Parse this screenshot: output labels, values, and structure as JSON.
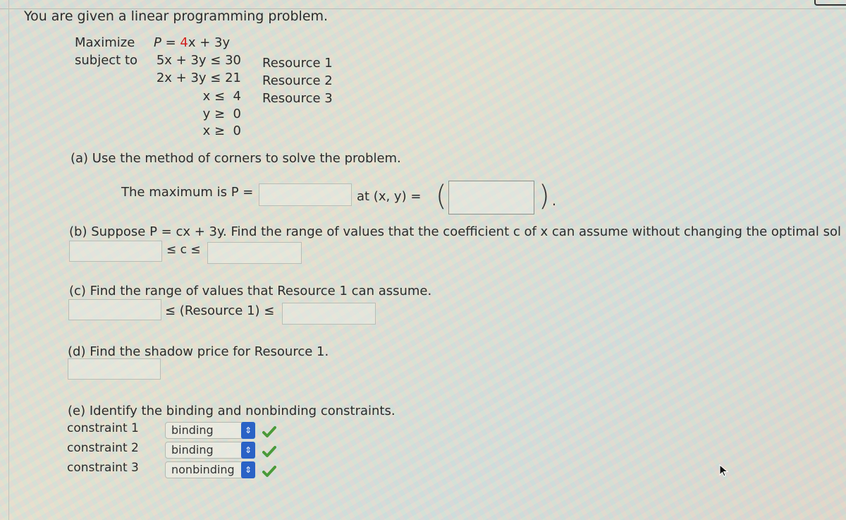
{
  "intro": "You are given a linear programming problem.",
  "problem": {
    "maximize_label": "Maximize",
    "objective_prefix": "P = ",
    "objective_coef": "4",
    "objective_rest": "x + 3y",
    "subject_to_label": "subject to",
    "constraints": [
      {
        "expr": "5x + 3y ≤ 30",
        "label": "Resource 1"
      },
      {
        "expr": "2x + 3y ≤ 21",
        "label": "Resource 2"
      },
      {
        "expr": "x ≤  4",
        "label": "Resource 3"
      },
      {
        "expr": "y ≥  0",
        "label": ""
      },
      {
        "expr": "x ≥  0",
        "label": ""
      }
    ]
  },
  "part_a": {
    "prompt": "(a) Use the method of corners to solve the problem.",
    "max_label": "The maximum is P =",
    "at_label": "at (x, y) =",
    "max_value": "",
    "point_value": ""
  },
  "part_b": {
    "prompt": "(b) Suppose P = cx + 3y. Find the range of values that the coefficient c of x can assume without changing the optimal sol",
    "between_label": "≤ c ≤",
    "lower_value": "",
    "upper_value": ""
  },
  "part_c": {
    "prompt": "(c) Find the range of values that Resource 1 can assume.",
    "between_label": "≤ (Resource 1) ≤",
    "lower_value": "",
    "upper_value": ""
  },
  "part_d": {
    "prompt": "(d) Find the shadow price for Resource 1.",
    "value": ""
  },
  "part_e": {
    "prompt": "(e) Identify the binding and nonbinding constraints.",
    "rows": [
      {
        "label": "constraint 1",
        "selected": "binding",
        "status": "correct"
      },
      {
        "label": "constraint 2",
        "selected": "binding",
        "status": "correct"
      },
      {
        "label": "constraint 3",
        "selected": "nonbinding",
        "status": "correct"
      }
    ]
  },
  "colors": {
    "accent_select": "#2a62c6",
    "check_green": "#4a9a3a",
    "highlight_red": "#d02020"
  }
}
